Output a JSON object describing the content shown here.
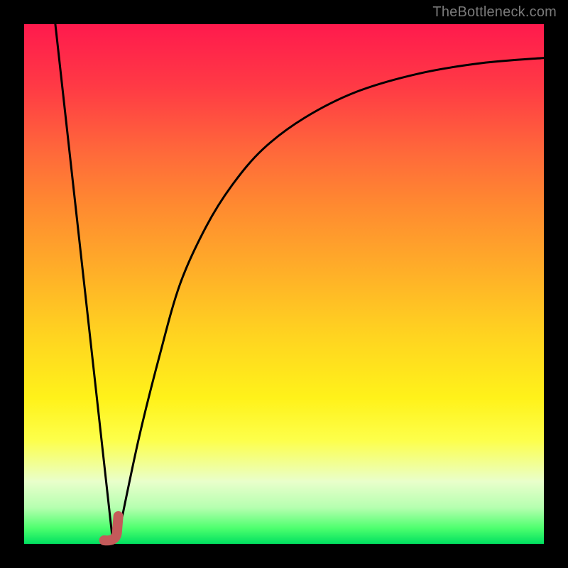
{
  "watermark": "TheBottleneck.com",
  "chart_data": {
    "type": "line",
    "title": "",
    "xlabel": "",
    "ylabel": "",
    "xlim": [
      0,
      100
    ],
    "ylim": [
      0,
      100
    ],
    "grid": false,
    "series": [
      {
        "name": "left-descent",
        "x": [
          6,
          17
        ],
        "values": [
          100,
          1
        ],
        "style": "straight"
      },
      {
        "name": "right-ascent",
        "x": [
          18,
          22,
          26,
          30,
          35,
          40,
          46,
          54,
          64,
          76,
          88,
          100
        ],
        "values": [
          1,
          20,
          36,
          50,
          61,
          69,
          76,
          82,
          87,
          90.5,
          92.5,
          93.5
        ],
        "style": "smooth"
      }
    ],
    "marker": {
      "name": "bottleneck-marker",
      "x": 17.3,
      "y": 1.5,
      "shape": "J",
      "color": "#c45a5a"
    },
    "background_gradient": {
      "stops": [
        {
          "pos": 0,
          "color": "#ff1a4d"
        },
        {
          "pos": 25,
          "color": "#ff6a3a"
        },
        {
          "pos": 50,
          "color": "#ffb028"
        },
        {
          "pos": 72,
          "color": "#fff21a"
        },
        {
          "pos": 88,
          "color": "#e9ffcb"
        },
        {
          "pos": 100,
          "color": "#00e060"
        }
      ]
    }
  }
}
